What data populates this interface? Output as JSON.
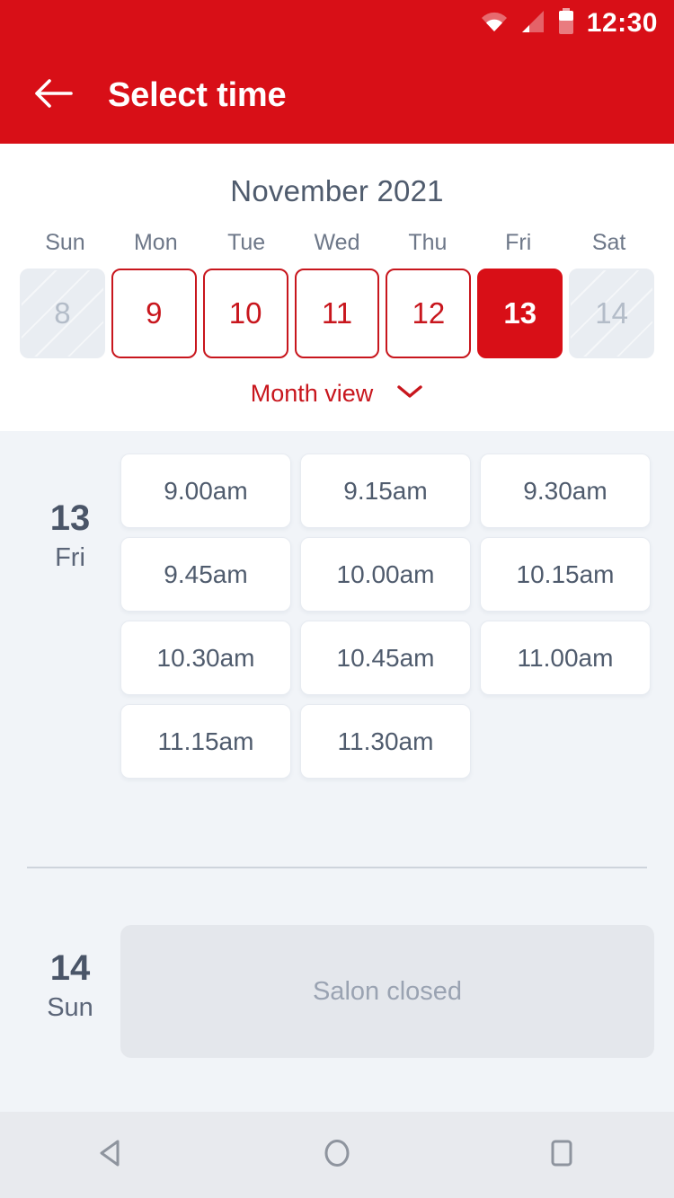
{
  "status_bar": {
    "time": "12:30",
    "icons": [
      "wifi-icon",
      "cellular-signal-icon",
      "battery-icon"
    ],
    "background_color": "#d80f17"
  },
  "app_bar": {
    "back_label": "back-arrow-icon",
    "title": "Select time",
    "background_color": "#d80f17",
    "text_color": "#ffffff"
  },
  "calendar": {
    "month_title": "November 2021",
    "day_names": [
      "Sun",
      "Mon",
      "Tue",
      "Wed",
      "Thu",
      "Fri",
      "Sat"
    ],
    "dates": [
      {
        "day": "8",
        "state": "disabled"
      },
      {
        "day": "9",
        "state": "available"
      },
      {
        "day": "10",
        "state": "available"
      },
      {
        "day": "11",
        "state": "available"
      },
      {
        "day": "12",
        "state": "available"
      },
      {
        "day": "13",
        "state": "selected"
      },
      {
        "day": "14",
        "state": "disabled"
      }
    ],
    "view_toggle_label": "Month view",
    "view_toggle_icon": "chevron-down-icon",
    "accent_color": "#c8161d",
    "selected_color": "#d80f17"
  },
  "days": [
    {
      "date_number": "13",
      "day_name": "Fri",
      "slots": [
        "9.00am",
        "9.15am",
        "9.30am",
        "9.45am",
        "10.00am",
        "10.15am",
        "10.30am",
        "10.45am",
        "11.00am",
        "11.15am",
        "11.30am"
      ],
      "closed_message": null
    },
    {
      "date_number": "14",
      "day_name": "Sun",
      "slots": [],
      "closed_message": "Salon closed"
    }
  ],
  "nav_bar": {
    "buttons": [
      "back-triangle-icon",
      "home-circle-icon",
      "recents-square-icon"
    ],
    "background_color": "#e8eaee"
  }
}
